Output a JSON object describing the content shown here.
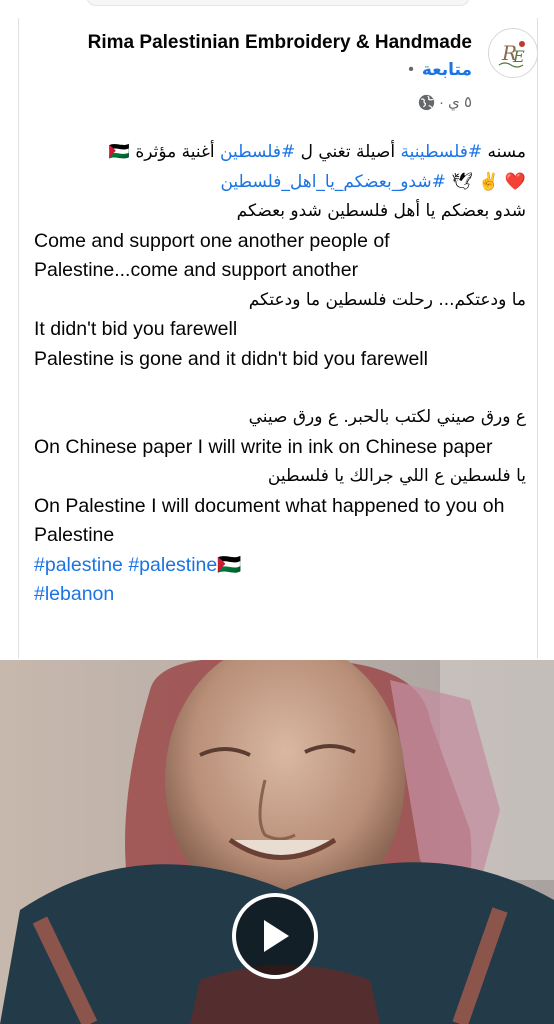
{
  "post": {
    "page_name": "Rima Palestinian Embroidery & Handmade",
    "follow_label": "متابعة",
    "separator_dot": "•",
    "time_label": "٥ ي",
    "time_dot": "·",
    "lines": [
      {
        "dir": "rtl",
        "parts": [
          {
            "t": "مسنه "
          },
          {
            "t": "#فلسطينية",
            "tag": true
          },
          {
            "t": " أصيلة تغني ل "
          },
          {
            "t": "#فلسطين",
            "tag": true
          },
          {
            "t": " أغنية مؤثرة 🇵🇸"
          }
        ]
      },
      {
        "dir": "rtl",
        "parts": [
          {
            "t": "❤️ ✌️ 🕊 "
          },
          {
            "t": "#شدو_بعضكم_يا_اهل_فلسطين",
            "tag": true
          }
        ]
      },
      {
        "dir": "rtl",
        "parts": [
          {
            "t": "شدو بعضكم  يا أهل فلسطين شدو بعضكم"
          }
        ]
      },
      {
        "dir": "ltr",
        "parts": [
          {
            "t": "Come and support one another people of Palestine...come and support another"
          }
        ]
      },
      {
        "dir": "rtl",
        "parts": [
          {
            "t": "ما ودعتكم... رحلت فلسطين ما ودعتكم"
          }
        ]
      },
      {
        "dir": "ltr",
        "parts": [
          {
            "t": "It didn't bid you farewell"
          }
        ]
      },
      {
        "dir": "ltr",
        "parts": [
          {
            "t": "Palestine is gone and it didn't bid you farewell"
          }
        ]
      },
      {
        "dir": "gap",
        "parts": []
      },
      {
        "dir": "rtl",
        "parts": [
          {
            "t": "ع ورق صيني لكتب بالحبر.  ع ورق صيني"
          }
        ]
      },
      {
        "dir": "ltr",
        "parts": [
          {
            "t": "On Chinese paper I will write in ink on Chinese paper"
          }
        ]
      },
      {
        "dir": "rtl",
        "parts": [
          {
            "t": "يا فلسطين ع اللي جرالك يا فلسطين"
          }
        ]
      },
      {
        "dir": "ltr",
        "parts": [
          {
            "t": "On Palestine I will document what happened to you oh Palestine"
          }
        ]
      },
      {
        "dir": "ltr",
        "parts": [
          {
            "t": "#palestine",
            "tag": true
          },
          {
            "t": " "
          },
          {
            "t": "#palestine",
            "tag": true
          },
          {
            "t": "🇵🇸"
          }
        ]
      },
      {
        "dir": "ltr",
        "parts": [
          {
            "t": "#lebanon",
            "tag": true
          }
        ]
      }
    ]
  },
  "icons": {
    "globe": "globe-icon",
    "play": "play-icon",
    "avatar": "page-logo-avatar"
  },
  "colors": {
    "link": "#1b74e4",
    "text": "#050505",
    "muted": "#65676b"
  }
}
